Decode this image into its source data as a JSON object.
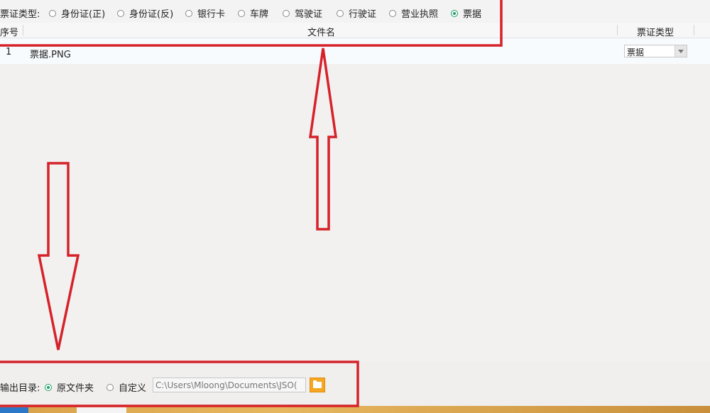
{
  "type_selector": {
    "label": "票证类型:",
    "options": [
      {
        "label": "身份证(正)",
        "checked": false
      },
      {
        "label": "身份证(反)",
        "checked": false
      },
      {
        "label": "银行卡",
        "checked": false
      },
      {
        "label": "车牌",
        "checked": false
      },
      {
        "label": "驾驶证",
        "checked": false
      },
      {
        "label": "行驶证",
        "checked": false
      },
      {
        "label": "营业执照",
        "checked": false
      },
      {
        "label": "票据",
        "checked": true
      }
    ]
  },
  "table": {
    "columns": [
      "序号",
      "文件名",
      "票证类型"
    ],
    "rows": [
      {
        "index": "1",
        "filename": "票据.PNG",
        "type": "票据"
      }
    ]
  },
  "output": {
    "label": "输出目录:",
    "options": [
      {
        "label": "原文件夹",
        "checked": true
      },
      {
        "label": "自定义",
        "checked": false
      }
    ],
    "path_value": "C:\\Users\\Mloong\\Documents\\JSO("
  },
  "icons": {
    "folder_button": "folder-icon",
    "select_arrow": "chevron-down-icon"
  },
  "colors": {
    "annotation_red": "#d6222a",
    "radio_green": "#1e9e67",
    "folder_orange": "#f5a623"
  }
}
